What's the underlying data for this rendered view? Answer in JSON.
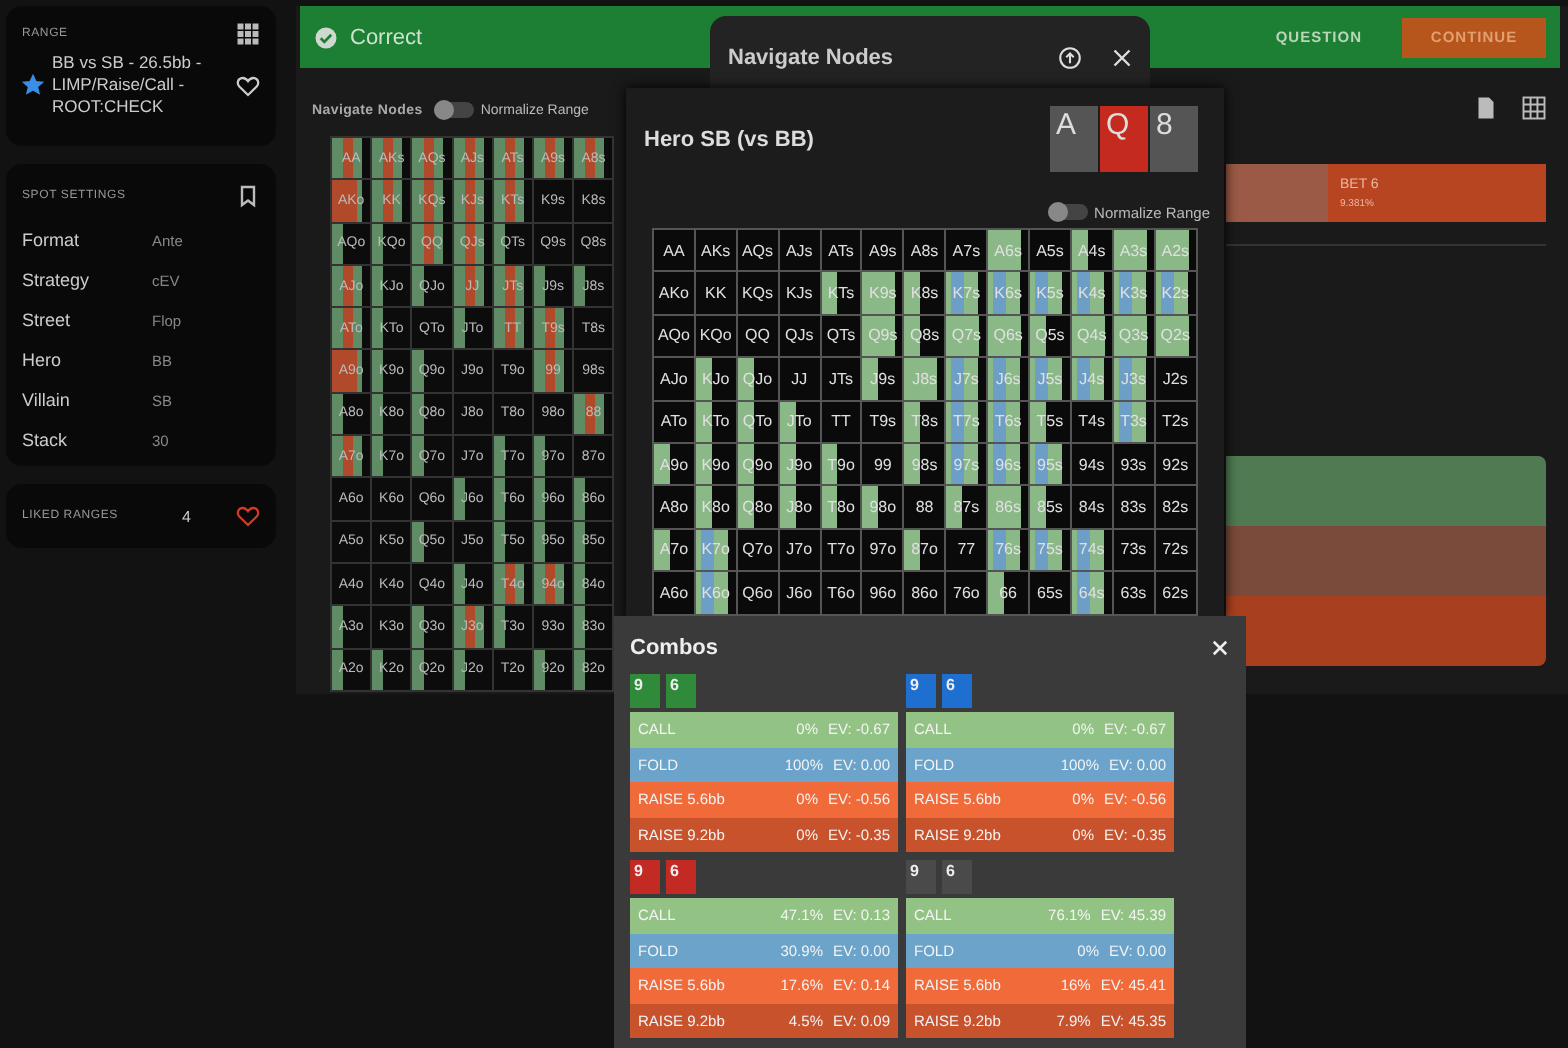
{
  "sidebar": {
    "range_card": {
      "title": "RANGE",
      "starred": true,
      "liked": false,
      "name": "BB vs SB - 26.5bb - LIMP/Raise/Call - ROOT:CHECK"
    },
    "spot_settings": {
      "title": "SPOT SETTINGS",
      "rows": [
        {
          "label": "Format",
          "value": "Ante"
        },
        {
          "label": "Strategy",
          "value": "cEV"
        },
        {
          "label": "Street",
          "value": "Flop"
        },
        {
          "label": "Hero",
          "value": "BB"
        },
        {
          "label": "Villain",
          "value": "SB"
        },
        {
          "label": "Stack",
          "value": "30"
        }
      ]
    },
    "liked_ranges": {
      "title": "LIKED RANGES",
      "count": "4",
      "liked": true
    }
  },
  "header": {
    "status": "Correct",
    "question_button": "QUESTION",
    "continue_button": "CONTINUE"
  },
  "background_grid": {
    "title": "Navigate Nodes",
    "normalize": {
      "label": "Normalize Range",
      "on": false
    },
    "rows": [
      {
        "cells": [
          {
            "hand": "AA",
            "kind": "mixed"
          },
          {
            "hand": "AKs",
            "kind": "mixed"
          },
          {
            "hand": "AQs",
            "kind": "mixed"
          },
          {
            "hand": "AJs",
            "kind": "mixed"
          },
          {
            "hand": "ATs",
            "kind": "mixed"
          },
          {
            "hand": "A9s",
            "kind": "mixed"
          },
          {
            "hand": "A8s",
            "kind": "mixed"
          }
        ]
      },
      {
        "cells": [
          {
            "hand": "AKo",
            "kind": "raise"
          },
          {
            "hand": "KK",
            "kind": "mixed"
          },
          {
            "hand": "KQs",
            "kind": "mixed"
          },
          {
            "hand": "KJs",
            "kind": "mixed"
          },
          {
            "hand": "KTs",
            "kind": "mixed"
          },
          {
            "hand": "K9s",
            "kind": "fold"
          },
          {
            "hand": "K8s",
            "kind": "fold"
          }
        ]
      },
      {
        "cells": [
          {
            "hand": "AQo",
            "kind": "partial"
          },
          {
            "hand": "KQo",
            "kind": "partial"
          },
          {
            "hand": "QQ",
            "kind": "mixed"
          },
          {
            "hand": "QJs",
            "kind": "mixed"
          },
          {
            "hand": "QTs",
            "kind": "partial"
          },
          {
            "hand": "Q9s",
            "kind": "fold"
          },
          {
            "hand": "Q8s",
            "kind": "fold"
          }
        ]
      },
      {
        "cells": [
          {
            "hand": "AJo",
            "kind": "mixed"
          },
          {
            "hand": "KJo",
            "kind": "partial"
          },
          {
            "hand": "QJo",
            "kind": "partial"
          },
          {
            "hand": "JJ",
            "kind": "mixed"
          },
          {
            "hand": "JTs",
            "kind": "mixed"
          },
          {
            "hand": "J9s",
            "kind": "partial"
          },
          {
            "hand": "J8s",
            "kind": "partial"
          }
        ]
      },
      {
        "cells": [
          {
            "hand": "ATo",
            "kind": "mixed"
          },
          {
            "hand": "KTo",
            "kind": "partial"
          },
          {
            "hand": "QTo",
            "kind": "fold"
          },
          {
            "hand": "JTo",
            "kind": "partial"
          },
          {
            "hand": "TT",
            "kind": "mixed"
          },
          {
            "hand": "T9s",
            "kind": "mixed"
          },
          {
            "hand": "T8s",
            "kind": "fold"
          }
        ]
      },
      {
        "cells": [
          {
            "hand": "A9o",
            "kind": "raise"
          },
          {
            "hand": "K9o",
            "kind": "partial"
          },
          {
            "hand": "Q9o",
            "kind": "partial"
          },
          {
            "hand": "J9o",
            "kind": "fold"
          },
          {
            "hand": "T9o",
            "kind": "fold"
          },
          {
            "hand": "99",
            "kind": "mixed"
          },
          {
            "hand": "98s",
            "kind": "fold"
          }
        ]
      },
      {
        "cells": [
          {
            "hand": "A8o",
            "kind": "partial"
          },
          {
            "hand": "K8o",
            "kind": "partial"
          },
          {
            "hand": "Q8o",
            "kind": "partial"
          },
          {
            "hand": "J8o",
            "kind": "fold"
          },
          {
            "hand": "T8o",
            "kind": "fold"
          },
          {
            "hand": "98o",
            "kind": "fold"
          },
          {
            "hand": "88",
            "kind": "mixed"
          }
        ]
      },
      {
        "cells": [
          {
            "hand": "A7o",
            "kind": "mixed"
          },
          {
            "hand": "K7o",
            "kind": "partial"
          },
          {
            "hand": "Q7o",
            "kind": "partial"
          },
          {
            "hand": "J7o",
            "kind": "fold"
          },
          {
            "hand": "T7o",
            "kind": "partial"
          },
          {
            "hand": "97o",
            "kind": "partial"
          },
          {
            "hand": "87o",
            "kind": "fold"
          }
        ]
      },
      {
        "cells": [
          {
            "hand": "A6o",
            "kind": "fold"
          },
          {
            "hand": "K6o",
            "kind": "fold"
          },
          {
            "hand": "Q6o",
            "kind": "fold"
          },
          {
            "hand": "J6o",
            "kind": "partial"
          },
          {
            "hand": "T6o",
            "kind": "partial"
          },
          {
            "hand": "96o",
            "kind": "partial"
          },
          {
            "hand": "86o",
            "kind": "partial"
          }
        ]
      },
      {
        "cells": [
          {
            "hand": "A5o",
            "kind": "fold"
          },
          {
            "hand": "K5o",
            "kind": "fold"
          },
          {
            "hand": "Q5o",
            "kind": "partial"
          },
          {
            "hand": "J5o",
            "kind": "fold"
          },
          {
            "hand": "T5o",
            "kind": "partial"
          },
          {
            "hand": "95o",
            "kind": "partial"
          },
          {
            "hand": "85o",
            "kind": "partial"
          }
        ]
      },
      {
        "cells": [
          {
            "hand": "A4o",
            "kind": "fold"
          },
          {
            "hand": "K4o",
            "kind": "fold"
          },
          {
            "hand": "Q4o",
            "kind": "fold"
          },
          {
            "hand": "J4o",
            "kind": "partial"
          },
          {
            "hand": "T4o",
            "kind": "mixed"
          },
          {
            "hand": "94o",
            "kind": "mixed"
          },
          {
            "hand": "84o",
            "kind": "partial"
          }
        ]
      },
      {
        "cells": [
          {
            "hand": "A3o",
            "kind": "partial"
          },
          {
            "hand": "K3o",
            "kind": "fold"
          },
          {
            "hand": "Q3o",
            "kind": "partial"
          },
          {
            "hand": "J3o",
            "kind": "mixed"
          },
          {
            "hand": "T3o",
            "kind": "partial"
          },
          {
            "hand": "93o",
            "kind": "fold"
          },
          {
            "hand": "83o",
            "kind": "partial"
          }
        ]
      },
      {
        "cells": [
          {
            "hand": "A2o",
            "kind": "partial"
          },
          {
            "hand": "K2o",
            "kind": "partial"
          },
          {
            "hand": "Q2o",
            "kind": "partial"
          },
          {
            "hand": "J2o",
            "kind": "partial"
          },
          {
            "hand": "T2o",
            "kind": "fold"
          },
          {
            "hand": "92o",
            "kind": "partial"
          },
          {
            "hand": "82o",
            "kind": "partial"
          }
        ]
      }
    ]
  },
  "right_panel": {
    "bet_bar": {
      "label": "BET 6",
      "percent": "9.381%"
    },
    "action_bars": [
      {
        "color": "#4f7a52"
      },
      {
        "color": "#7a4a3a"
      },
      {
        "color": "#a8401f"
      }
    ]
  },
  "navigate_dialog": {
    "title": "Navigate Nodes"
  },
  "hero_popup": {
    "title": "Hero SB (vs BB)",
    "board": [
      {
        "rank": "A",
        "color": "#555555"
      },
      {
        "rank": "Q",
        "color": "#c42a1e"
      },
      {
        "rank": "8",
        "color": "#555555"
      }
    ],
    "normalize": {
      "label": "Normalize Range",
      "on": false
    },
    "rows": [
      {
        "cells": [
          {
            "hand": "AA",
            "kind": "none"
          },
          {
            "hand": "AKs",
            "kind": "none"
          },
          {
            "hand": "AQs",
            "kind": "none"
          },
          {
            "hand": "AJs",
            "kind": "none"
          },
          {
            "hand": "ATs",
            "kind": "none"
          },
          {
            "hand": "A9s",
            "kind": "none"
          },
          {
            "hand": "A8s",
            "kind": "none"
          },
          {
            "hand": "A7s",
            "kind": "none"
          },
          {
            "hand": "A6s",
            "kind": "call"
          },
          {
            "hand": "A5s",
            "kind": "none"
          },
          {
            "hand": "A4s",
            "kind": "half"
          },
          {
            "hand": "A3s",
            "kind": "call"
          },
          {
            "hand": "A2s",
            "kind": "call"
          }
        ]
      },
      {
        "cells": [
          {
            "hand": "AKo",
            "kind": "none"
          },
          {
            "hand": "KK",
            "kind": "none"
          },
          {
            "hand": "KQs",
            "kind": "none"
          },
          {
            "hand": "KJs",
            "kind": "none"
          },
          {
            "hand": "KTs",
            "kind": "half"
          },
          {
            "hand": "K9s",
            "kind": "call"
          },
          {
            "hand": "K8s",
            "kind": "half"
          },
          {
            "hand": "K7s",
            "kind": "mixed"
          },
          {
            "hand": "K6s",
            "kind": "mixed"
          },
          {
            "hand": "K5s",
            "kind": "mixed"
          },
          {
            "hand": "K4s",
            "kind": "mixed"
          },
          {
            "hand": "K3s",
            "kind": "mixed"
          },
          {
            "hand": "K2s",
            "kind": "mixed"
          }
        ]
      },
      {
        "cells": [
          {
            "hand": "AQo",
            "kind": "none"
          },
          {
            "hand": "KQo",
            "kind": "none"
          },
          {
            "hand": "QQ",
            "kind": "none"
          },
          {
            "hand": "QJs",
            "kind": "none"
          },
          {
            "hand": "QTs",
            "kind": "none"
          },
          {
            "hand": "Q9s",
            "kind": "call"
          },
          {
            "hand": "Q8s",
            "kind": "half"
          },
          {
            "hand": "Q7s",
            "kind": "call"
          },
          {
            "hand": "Q6s",
            "kind": "call"
          },
          {
            "hand": "Q5s",
            "kind": "half"
          },
          {
            "hand": "Q4s",
            "kind": "call"
          },
          {
            "hand": "Q3s",
            "kind": "call"
          },
          {
            "hand": "Q2s",
            "kind": "call"
          }
        ]
      },
      {
        "cells": [
          {
            "hand": "AJo",
            "kind": "none"
          },
          {
            "hand": "KJo",
            "kind": "half"
          },
          {
            "hand": "QJo",
            "kind": "half"
          },
          {
            "hand": "JJ",
            "kind": "none"
          },
          {
            "hand": "JTs",
            "kind": "none"
          },
          {
            "hand": "J9s",
            "kind": "half"
          },
          {
            "hand": "J8s",
            "kind": "call"
          },
          {
            "hand": "J7s",
            "kind": "mixed"
          },
          {
            "hand": "J6s",
            "kind": "mixed"
          },
          {
            "hand": "J5s",
            "kind": "mixed"
          },
          {
            "hand": "J4s",
            "kind": "mixed"
          },
          {
            "hand": "J3s",
            "kind": "mixed"
          },
          {
            "hand": "J2s",
            "kind": "none"
          }
        ]
      },
      {
        "cells": [
          {
            "hand": "ATo",
            "kind": "none"
          },
          {
            "hand": "KTo",
            "kind": "half"
          },
          {
            "hand": "QTo",
            "kind": "half"
          },
          {
            "hand": "JTo",
            "kind": "half"
          },
          {
            "hand": "TT",
            "kind": "none"
          },
          {
            "hand": "T9s",
            "kind": "none"
          },
          {
            "hand": "T8s",
            "kind": "half"
          },
          {
            "hand": "T7s",
            "kind": "mixed"
          },
          {
            "hand": "T6s",
            "kind": "mixed"
          },
          {
            "hand": "T5s",
            "kind": "half"
          },
          {
            "hand": "T4s",
            "kind": "none"
          },
          {
            "hand": "T3s",
            "kind": "mixed"
          },
          {
            "hand": "T2s",
            "kind": "none"
          }
        ]
      },
      {
        "cells": [
          {
            "hand": "A9o",
            "kind": "half"
          },
          {
            "hand": "K9o",
            "kind": "half"
          },
          {
            "hand": "Q9o",
            "kind": "half"
          },
          {
            "hand": "J9o",
            "kind": "half"
          },
          {
            "hand": "T9o",
            "kind": "half"
          },
          {
            "hand": "99",
            "kind": "none"
          },
          {
            "hand": "98s",
            "kind": "half"
          },
          {
            "hand": "97s",
            "kind": "mixed"
          },
          {
            "hand": "96s",
            "kind": "mixed"
          },
          {
            "hand": "95s",
            "kind": "mixed"
          },
          {
            "hand": "94s",
            "kind": "none"
          },
          {
            "hand": "93s",
            "kind": "none"
          },
          {
            "hand": "92s",
            "kind": "none"
          }
        ]
      },
      {
        "cells": [
          {
            "hand": "A8o",
            "kind": "none"
          },
          {
            "hand": "K8o",
            "kind": "half"
          },
          {
            "hand": "Q8o",
            "kind": "half"
          },
          {
            "hand": "J8o",
            "kind": "half"
          },
          {
            "hand": "T8o",
            "kind": "half"
          },
          {
            "hand": "98o",
            "kind": "half"
          },
          {
            "hand": "88",
            "kind": "none"
          },
          {
            "hand": "87s",
            "kind": "half"
          },
          {
            "hand": "86s",
            "kind": "call"
          },
          {
            "hand": "85s",
            "kind": "half"
          },
          {
            "hand": "84s",
            "kind": "none"
          },
          {
            "hand": "83s",
            "kind": "none"
          },
          {
            "hand": "82s",
            "kind": "none"
          }
        ]
      },
      {
        "cells": [
          {
            "hand": "A7o",
            "kind": "half"
          },
          {
            "hand": "K7o",
            "kind": "mixed"
          },
          {
            "hand": "Q7o",
            "kind": "none"
          },
          {
            "hand": "J7o",
            "kind": "none"
          },
          {
            "hand": "T7o",
            "kind": "none"
          },
          {
            "hand": "97o",
            "kind": "none"
          },
          {
            "hand": "87o",
            "kind": "half"
          },
          {
            "hand": "77",
            "kind": "none"
          },
          {
            "hand": "76s",
            "kind": "mixed"
          },
          {
            "hand": "75s",
            "kind": "mixed"
          },
          {
            "hand": "74s",
            "kind": "mixed"
          },
          {
            "hand": "73s",
            "kind": "none"
          },
          {
            "hand": "72s",
            "kind": "none"
          }
        ]
      },
      {
        "cells": [
          {
            "hand": "A6o",
            "kind": "none"
          },
          {
            "hand": "K6o",
            "kind": "mixed"
          },
          {
            "hand": "Q6o",
            "kind": "none"
          },
          {
            "hand": "J6o",
            "kind": "none"
          },
          {
            "hand": "T6o",
            "kind": "none"
          },
          {
            "hand": "96o",
            "kind": "none"
          },
          {
            "hand": "86o",
            "kind": "none"
          },
          {
            "hand": "76o",
            "kind": "none"
          },
          {
            "hand": "66",
            "kind": "half"
          },
          {
            "hand": "65s",
            "kind": "none"
          },
          {
            "hand": "64s",
            "kind": "mixed"
          },
          {
            "hand": "63s",
            "kind": "none"
          },
          {
            "hand": "62s",
            "kind": "none"
          }
        ]
      }
    ]
  },
  "combos_popup": {
    "title": "Combos",
    "combos": [
      {
        "cards": [
          {
            "rank": "9",
            "color": "#2f8a3a"
          },
          {
            "rank": "6",
            "color": "#2f8a3a"
          }
        ],
        "actions": [
          {
            "kind": "call",
            "label": "CALL",
            "percent": "0%",
            "ev": "EV: -0.67"
          },
          {
            "kind": "fold",
            "label": "FOLD",
            "percent": "100%",
            "ev": "EV: 0.00"
          },
          {
            "kind": "raise",
            "label": "RAISE 5.6bb",
            "percent": "0%",
            "ev": "EV: -0.56"
          },
          {
            "kind": "raise-large",
            "label": "RAISE 9.2bb",
            "percent": "0%",
            "ev": "EV: -0.35"
          }
        ]
      },
      {
        "cards": [
          {
            "rank": "9",
            "color": "#1f6fd1"
          },
          {
            "rank": "6",
            "color": "#1f6fd1"
          }
        ],
        "actions": [
          {
            "kind": "call",
            "label": "CALL",
            "percent": "0%",
            "ev": "EV: -0.67"
          },
          {
            "kind": "fold",
            "label": "FOLD",
            "percent": "100%",
            "ev": "EV: 0.00"
          },
          {
            "kind": "raise",
            "label": "RAISE 5.6bb",
            "percent": "0%",
            "ev": "EV: -0.56"
          },
          {
            "kind": "raise-large",
            "label": "RAISE 9.2bb",
            "percent": "0%",
            "ev": "EV: -0.35"
          }
        ]
      },
      {
        "cards": [
          {
            "rank": "9",
            "color": "#c42a24"
          },
          {
            "rank": "6",
            "color": "#c42a24"
          }
        ],
        "actions": [
          {
            "kind": "call",
            "label": "CALL",
            "percent": "47.1%",
            "ev": "EV: 0.13"
          },
          {
            "kind": "fold",
            "label": "FOLD",
            "percent": "30.9%",
            "ev": "EV: 0.00"
          },
          {
            "kind": "raise",
            "label": "RAISE 5.6bb",
            "percent": "17.6%",
            "ev": "EV: 0.14"
          },
          {
            "kind": "raise-large",
            "label": "RAISE 9.2bb",
            "percent": "4.5%",
            "ev": "EV: 0.09"
          }
        ]
      },
      {
        "cards": [
          {
            "rank": "9",
            "color": "#4a4a4a"
          },
          {
            "rank": "6",
            "color": "#4a4a4a"
          }
        ],
        "actions": [
          {
            "kind": "call",
            "label": "CALL",
            "percent": "76.1%",
            "ev": "EV: 45.39"
          },
          {
            "kind": "fold",
            "label": "FOLD",
            "percent": "0%",
            "ev": "EV: 0.00"
          },
          {
            "kind": "raise",
            "label": "RAISE 5.6bb",
            "percent": "16%",
            "ev": "EV: 45.41"
          },
          {
            "kind": "raise-large",
            "label": "RAISE 9.2bb",
            "percent": "7.9%",
            "ev": "EV: 45.35"
          }
        ]
      }
    ]
  }
}
